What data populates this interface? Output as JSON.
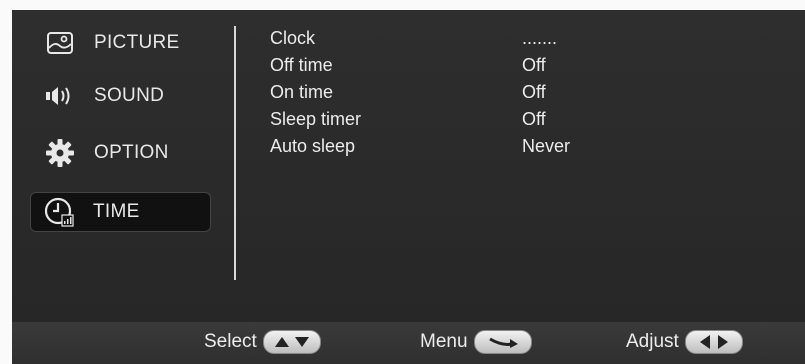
{
  "sidebar": {
    "items": [
      {
        "label": "PICTURE",
        "icon": "picture-icon",
        "selected": false
      },
      {
        "label": "SOUND",
        "icon": "speaker-icon",
        "selected": false
      },
      {
        "label": "OPTION",
        "icon": "gear-icon",
        "selected": false
      },
      {
        "label": "TIME",
        "icon": "clock-icon",
        "selected": true
      }
    ]
  },
  "settings": {
    "rows": [
      {
        "label": "Clock",
        "value": "......."
      },
      {
        "label": "Off time",
        "value": "Off"
      },
      {
        "label": "On time",
        "value": "Off"
      },
      {
        "label": "Sleep timer",
        "value": "Off"
      },
      {
        "label": "Auto sleep",
        "value": "Never"
      }
    ]
  },
  "footer": {
    "select_label": "Select",
    "menu_label": "Menu",
    "adjust_label": "Adjust"
  },
  "colors": {
    "background": "#2b2b2b",
    "footer": "#353535",
    "text": "#ececec",
    "selected_bg": "#111111"
  }
}
